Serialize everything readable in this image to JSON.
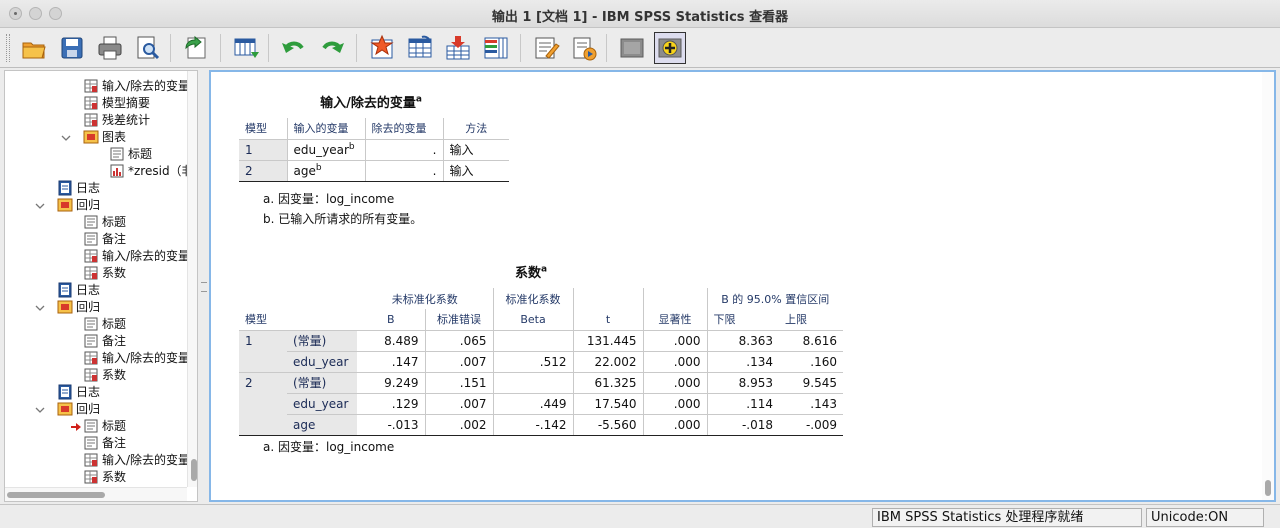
{
  "window": {
    "title": "输出 1 [文档 1] - IBM SPSS Statistics 查看器"
  },
  "toolbar": {
    "buttons": [
      "open-icon",
      "save-icon",
      "print-icon",
      "print-preview-icon",
      "export-icon",
      "goto-data-icon",
      "undo-icon",
      "redo-icon",
      "goto-case-icon",
      "goto-variable-icon",
      "insert-variable-icon",
      "variables-icon",
      "designate-window-icon",
      "insert-heading-icon",
      "insert-title-icon",
      "hide-icon",
      "show-icon"
    ]
  },
  "tree": {
    "items": [
      {
        "label": "输入/除去的变量",
        "icon": "table-icon"
      },
      {
        "label": "模型摘要",
        "icon": "table-icon"
      },
      {
        "label": "残差统计",
        "icon": "table-icon"
      },
      {
        "label": "图表",
        "icon": "folder-icon"
      },
      {
        "label": "标题",
        "icon": "title-icon"
      },
      {
        "label": "*zresid（非",
        "icon": "chart-icon"
      },
      {
        "label": "日志",
        "icon": "log-icon"
      },
      {
        "label": "回归",
        "icon": "folder-icon"
      },
      {
        "label": "标题",
        "icon": "title-icon"
      },
      {
        "label": "备注",
        "icon": "notes-icon"
      },
      {
        "label": "输入/除去的变量",
        "icon": "table-icon"
      },
      {
        "label": "系数",
        "icon": "table-icon"
      },
      {
        "label": "日志",
        "icon": "log-icon"
      },
      {
        "label": "回归",
        "icon": "folder-icon"
      },
      {
        "label": "标题",
        "icon": "title-icon"
      },
      {
        "label": "备注",
        "icon": "notes-icon"
      },
      {
        "label": "输入/除去的变量",
        "icon": "table-icon"
      },
      {
        "label": "系数",
        "icon": "table-icon"
      },
      {
        "label": "日志",
        "icon": "log-icon"
      },
      {
        "label": "回归",
        "icon": "folder-icon"
      },
      {
        "label": "标题",
        "icon": "title-icon"
      },
      {
        "label": "备注",
        "icon": "notes-icon"
      },
      {
        "label": "输入/除去的变量",
        "icon": "table-icon"
      },
      {
        "label": "系数",
        "icon": "table-icon"
      }
    ]
  },
  "table1": {
    "title": "输入/除去的变量",
    "title_sup": "a",
    "headers": [
      "模型",
      "输入的变量",
      "除去的变量",
      "方法"
    ],
    "rows": [
      {
        "model": "1",
        "entered": "edu_year",
        "entered_sup": "b",
        "removed": ".",
        "method": "输入"
      },
      {
        "model": "2",
        "entered": "age",
        "entered_sup": "b",
        "removed": ".",
        "method": "输入"
      }
    ],
    "footnotes": [
      "a. 因变量：log_income",
      "b. 已输入所请求的所有变量。"
    ]
  },
  "table2": {
    "title": "系数",
    "title_sup": "a",
    "header_model": "模型",
    "group_unstd": "未标准化系数",
    "group_std": "标准化系数",
    "group_ci": "B 的 95.0% 置信区间",
    "col_B": "B",
    "col_se": "标准错误",
    "col_beta": "Beta",
    "col_t": "t",
    "col_sig": "显著性",
    "col_lower": "下限",
    "col_upper": "上限",
    "rows": [
      {
        "model": "1",
        "var": "(常量)",
        "B": "8.489",
        "se": ".065",
        "beta": "",
        "t": "131.445",
        "sig": ".000",
        "lower": "8.363",
        "upper": "8.616"
      },
      {
        "model": "",
        "var": "edu_year",
        "B": ".147",
        "se": ".007",
        "beta": ".512",
        "t": "22.002",
        "sig": ".000",
        "lower": ".134",
        "upper": ".160"
      },
      {
        "model": "2",
        "var": "(常量)",
        "B": "9.249",
        "se": ".151",
        "beta": "",
        "t": "61.325",
        "sig": ".000",
        "lower": "8.953",
        "upper": "9.545"
      },
      {
        "model": "",
        "var": "edu_year",
        "B": ".129",
        "se": ".007",
        "beta": ".449",
        "t": "17.540",
        "sig": ".000",
        "lower": ".114",
        "upper": ".143"
      },
      {
        "model": "",
        "var": "age",
        "B": "-.013",
        "se": ".002",
        "beta": "-.142",
        "t": "-5.560",
        "sig": ".000",
        "lower": "-.018",
        "upper": "-.009"
      }
    ],
    "footnote": "a. 因变量：log_income"
  },
  "status": {
    "processor": "IBM SPSS Statistics 处理程序就绪",
    "unicode": "Unicode:ON"
  }
}
